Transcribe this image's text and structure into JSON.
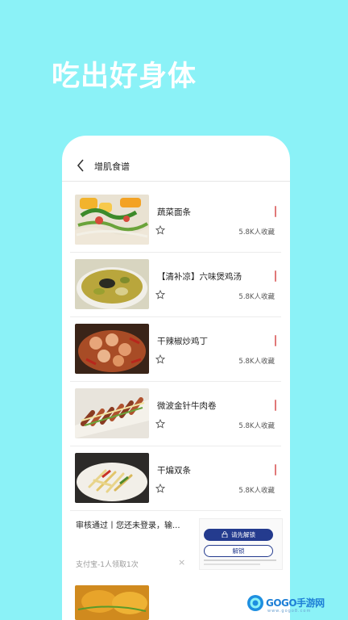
{
  "hero": {
    "title": "吃出好身体"
  },
  "nav": {
    "title": "增肌食谱",
    "back_icon": "chevron-left-icon"
  },
  "recipes": [
    {
      "name": "蔬菜面条",
      "count": "5.8K人收藏"
    },
    {
      "name": "【清补凉】六味煲鸡汤",
      "count": "5.8K人收藏"
    },
    {
      "name": "干辣椒炒鸡丁",
      "count": "5.8K人收藏"
    },
    {
      "name": "微波金针牛肉卷",
      "count": "5.8K人收藏"
    },
    {
      "name": "干煸双条",
      "count": "5.8K人收藏"
    }
  ],
  "ad": {
    "title": "审核通过丨您还未登录，输...",
    "source": "支付宝-1人领取1次",
    "close": "×",
    "button_primary": "请先解锁",
    "button_secondary": "解锁"
  },
  "watermark": {
    "brand": "GOGO手游网",
    "url": "www.gogo8.com"
  },
  "colors": {
    "background": "#8bf2f7",
    "accent_mark": "#e07878",
    "ad_button": "#243b8e"
  }
}
